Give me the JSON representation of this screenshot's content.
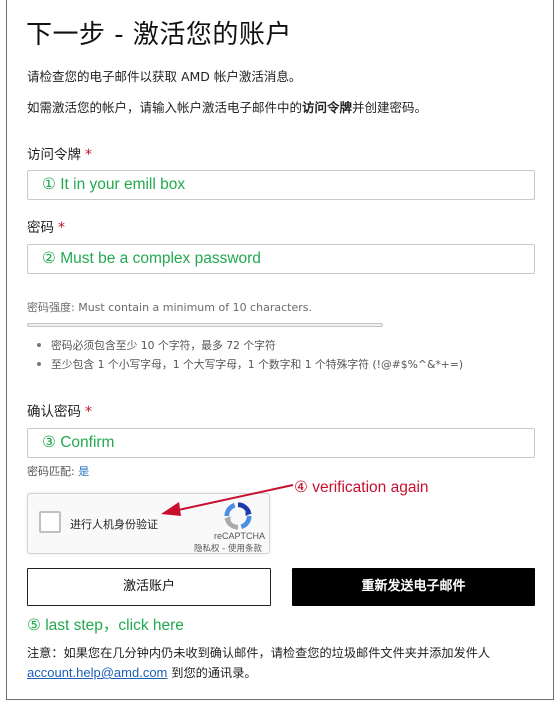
{
  "header": {
    "title": "下一步 - 激活您的账户"
  },
  "intro": {
    "line1": "请检查您的电子邮件以获取 AMD 帐户激活消息。",
    "line2_prefix": "如需激活您的帐户，请输入帐户激活电子邮件中的",
    "line2_bold": "访问令牌",
    "line2_suffix": "并创建密码。"
  },
  "form": {
    "required_mark": "*",
    "token": {
      "label": "访问令牌",
      "value": "①   It in your emill box"
    },
    "password": {
      "label": "密码",
      "value": "② Must be a complex password",
      "strength_text": "密码强度: Must contain a minimum of 10 characters.",
      "strength_level": 0,
      "rules": [
        "密码必须包含至少 10 个字符，最多 72 个字符",
        "至少包含 1 个小写字母，1 个大写字母，1 个数字和 1 个特殊字符 (!@#$%^&*+=)"
      ]
    },
    "confirm": {
      "label": "确认密码",
      "value": "③  Confirm",
      "match_label": "密码匹配: ",
      "match_value": "是"
    }
  },
  "captcha": {
    "label": "进行人机身份验证",
    "brand": "reCAPTCHA",
    "links": "隐私权 - 使用条款",
    "checked": false
  },
  "annotations": {
    "verification": "④ verification again",
    "last_step": "⑤ last step，click here",
    "colors": {
      "red": "#c8102e",
      "green": "#22a94f"
    }
  },
  "buttons": {
    "activate": "激活账户",
    "resend": "重新发送电子邮件"
  },
  "note": {
    "prefix": "注意：如果您在几分钟内仍未收到确认邮件，请检查您的垃圾邮件文件夹并添加发件人 ",
    "email": "account.help@amd.com",
    "suffix": " 到您的通讯录。"
  }
}
